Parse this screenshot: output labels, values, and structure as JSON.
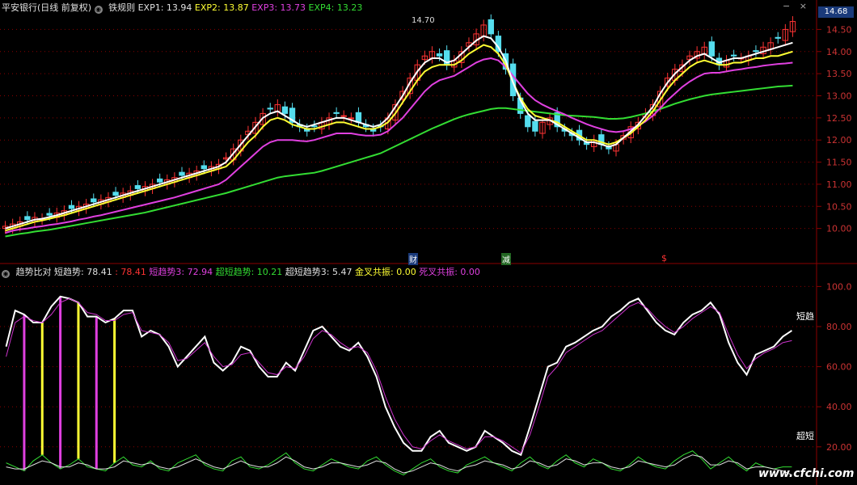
{
  "header_top": {
    "security": "平安银行(日线 前复权)",
    "indicator": "铁规则",
    "exp1": "EXP1: 13.94",
    "exp2": "EXP2: 13.87",
    "exp3": "EXP3: 13.73",
    "exp4": "EXP4: 13.23"
  },
  "header_bottom": {
    "indicator": "趋势比对",
    "short_trend": "短趋势: 78.41",
    "short_trend_val": ": 78.41",
    "short_trend3": "短趋势3: 72.94",
    "super_short": "超短趋势: 10.21",
    "super_short3": "超短趋势3: 5.47",
    "golden_cross": "金叉共振: 0.00",
    "death_cross": "死叉共振: 0.00"
  },
  "current_price": "14.68",
  "high_label": "14.70",
  "markers": {
    "cai": "财",
    "jian": "减",
    "dollar": "$"
  },
  "side_labels": {
    "short": "短趋",
    "super_short": "超短"
  },
  "watermark": "www.cfchi.com",
  "window_icons": {
    "minimize": "−",
    "close": "×"
  },
  "colors": {
    "up": "#ff3333",
    "down": "#55ddee",
    "exp1": "#ffffff",
    "exp2": "#ffff33",
    "exp3": "#e040e0",
    "exp4": "#33dd33",
    "grid": "#8b0000"
  },
  "chart_data": [
    {
      "type": "candlestick",
      "title": "铁规则",
      "ylim": [
        9.5,
        14.8
      ],
      "yticks": [
        "14.50",
        "14.00",
        "13.50",
        "13.00",
        "12.50",
        "12.00",
        "11.50",
        "11.00",
        "10.50",
        "10.00"
      ],
      "ytick_values": [
        14.5,
        14.0,
        13.5,
        13.0,
        12.5,
        12.0,
        11.5,
        11.0,
        10.5,
        10.0
      ],
      "close": [
        10.05,
        10.1,
        10.15,
        10.2,
        10.25,
        10.22,
        10.3,
        10.35,
        10.4,
        10.45,
        10.5,
        10.55,
        10.6,
        10.65,
        10.7,
        10.75,
        10.8,
        10.85,
        10.9,
        10.95,
        11.0,
        11.05,
        11.1,
        11.15,
        11.2,
        11.25,
        11.3,
        11.35,
        11.4,
        11.45,
        11.6,
        11.8,
        12.0,
        12.2,
        12.4,
        12.6,
        12.7,
        12.8,
        12.6,
        12.4,
        12.3,
        12.2,
        12.3,
        12.4,
        12.5,
        12.6,
        12.55,
        12.5,
        12.4,
        12.3,
        12.2,
        12.3,
        12.5,
        12.8,
        13.1,
        13.4,
        13.7,
        13.9,
        14.0,
        13.9,
        13.7,
        13.8,
        14.0,
        14.2,
        14.4,
        14.6,
        14.4,
        14.0,
        13.6,
        13.0,
        12.6,
        12.3,
        12.2,
        12.4,
        12.5,
        12.3,
        12.2,
        12.1,
        12.0,
        11.9,
        12.0,
        11.9,
        11.8,
        11.9,
        12.1,
        12.3,
        12.4,
        12.6,
        12.8,
        13.1,
        13.4,
        13.6,
        13.7,
        13.9,
        14.0,
        14.1,
        13.9,
        13.7,
        13.8,
        13.9,
        13.85,
        13.9,
        14.0,
        14.1,
        14.2,
        14.3,
        14.5,
        14.68
      ],
      "exp1": [
        10.0,
        10.05,
        10.1,
        10.15,
        10.2,
        10.22,
        10.26,
        10.3,
        10.35,
        10.4,
        10.45,
        10.5,
        10.55,
        10.6,
        10.65,
        10.7,
        10.75,
        10.8,
        10.85,
        10.9,
        10.95,
        11.0,
        11.05,
        11.1,
        11.15,
        11.2,
        11.25,
        11.3,
        11.35,
        11.4,
        11.5,
        11.7,
        11.9,
        12.1,
        12.3,
        12.5,
        12.6,
        12.65,
        12.55,
        12.45,
        12.35,
        12.3,
        12.35,
        12.4,
        12.45,
        12.5,
        12.5,
        12.45,
        12.4,
        12.35,
        12.3,
        12.35,
        12.5,
        12.75,
        13.0,
        13.3,
        13.55,
        13.75,
        13.85,
        13.85,
        13.75,
        13.8,
        13.95,
        14.1,
        14.25,
        14.35,
        14.3,
        14.1,
        13.8,
        13.3,
        12.9,
        12.6,
        12.45,
        12.45,
        12.45,
        12.35,
        12.25,
        12.15,
        12.05,
        11.95,
        11.95,
        11.9,
        11.85,
        11.9,
        12.05,
        12.2,
        12.35,
        12.55,
        12.75,
        13.05,
        13.3,
        13.5,
        13.65,
        13.8,
        13.9,
        13.95,
        13.85,
        13.75,
        13.8,
        13.85,
        13.85,
        13.9,
        13.95,
        14.0,
        14.05,
        14.1,
        14.15,
        14.2
      ],
      "exp2": [
        9.95,
        10.0,
        10.05,
        10.1,
        10.15,
        10.18,
        10.22,
        10.26,
        10.3,
        10.35,
        10.4,
        10.45,
        10.5,
        10.55,
        10.6,
        10.65,
        10.7,
        10.75,
        10.8,
        10.85,
        10.9,
        10.95,
        11.0,
        11.05,
        11.1,
        11.15,
        11.2,
        11.25,
        11.3,
        11.35,
        11.4,
        11.55,
        11.75,
        11.95,
        12.1,
        12.3,
        12.45,
        12.5,
        12.45,
        12.35,
        12.3,
        12.25,
        12.25,
        12.3,
        12.35,
        12.4,
        12.4,
        12.35,
        12.3,
        12.25,
        12.25,
        12.3,
        12.4,
        12.6,
        12.85,
        13.1,
        13.35,
        13.55,
        13.65,
        13.7,
        13.7,
        13.7,
        13.8,
        13.95,
        14.05,
        14.15,
        14.1,
        13.95,
        13.7,
        13.3,
        12.95,
        12.7,
        12.55,
        12.5,
        12.45,
        12.4,
        12.3,
        12.2,
        12.1,
        12.0,
        12.0,
        11.95,
        11.9,
        11.95,
        12.05,
        12.15,
        12.3,
        12.45,
        12.65,
        12.9,
        13.15,
        13.35,
        13.5,
        13.65,
        13.75,
        13.8,
        13.75,
        13.7,
        13.7,
        13.75,
        13.75,
        13.8,
        13.85,
        13.85,
        13.9,
        13.9,
        13.95,
        14.0
      ],
      "exp3": [
        9.9,
        9.95,
        9.98,
        10.0,
        10.03,
        10.05,
        10.08,
        10.1,
        10.13,
        10.16,
        10.2,
        10.23,
        10.27,
        10.3,
        10.34,
        10.38,
        10.42,
        10.46,
        10.5,
        10.54,
        10.58,
        10.62,
        10.66,
        10.7,
        10.75,
        10.8,
        10.85,
        10.9,
        10.95,
        11.0,
        11.1,
        11.25,
        11.4,
        11.55,
        11.7,
        11.85,
        11.95,
        12.0,
        12.0,
        12.0,
        11.98,
        11.97,
        12.0,
        12.05,
        12.1,
        12.15,
        12.15,
        12.15,
        12.12,
        12.1,
        12.1,
        12.12,
        12.2,
        12.35,
        12.5,
        12.7,
        12.9,
        13.1,
        13.25,
        13.35,
        13.4,
        13.45,
        13.55,
        13.65,
        13.75,
        13.82,
        13.85,
        13.8,
        13.65,
        13.45,
        13.25,
        13.05,
        12.9,
        12.8,
        12.72,
        12.65,
        12.58,
        12.5,
        12.43,
        12.36,
        12.3,
        12.25,
        12.2,
        12.18,
        12.2,
        12.25,
        12.32,
        12.42,
        12.55,
        12.72,
        12.9,
        13.05,
        13.2,
        13.32,
        13.42,
        13.5,
        13.52,
        13.52,
        13.55,
        13.58,
        13.6,
        13.63,
        13.65,
        13.68,
        13.7,
        13.72,
        13.73,
        13.75
      ],
      "exp4": [
        9.82,
        9.85,
        9.88,
        9.9,
        9.93,
        9.95,
        9.97,
        10.0,
        10.03,
        10.06,
        10.09,
        10.12,
        10.15,
        10.18,
        10.21,
        10.24,
        10.27,
        10.3,
        10.33,
        10.36,
        10.4,
        10.44,
        10.48,
        10.52,
        10.56,
        10.6,
        10.64,
        10.68,
        10.72,
        10.76,
        10.8,
        10.85,
        10.9,
        10.95,
        11.0,
        11.05,
        11.1,
        11.15,
        11.18,
        11.2,
        11.22,
        11.24,
        11.26,
        11.3,
        11.35,
        11.4,
        11.45,
        11.5,
        11.55,
        11.6,
        11.65,
        11.7,
        11.78,
        11.86,
        11.94,
        12.02,
        12.1,
        12.18,
        12.26,
        12.33,
        12.4,
        12.47,
        12.53,
        12.58,
        12.62,
        12.66,
        12.7,
        12.72,
        12.72,
        12.7,
        12.68,
        12.66,
        12.64,
        12.62,
        12.6,
        12.58,
        12.56,
        12.55,
        12.54,
        12.53,
        12.52,
        12.5,
        12.48,
        12.48,
        12.49,
        12.52,
        12.56,
        12.6,
        12.65,
        12.7,
        12.76,
        12.82,
        12.87,
        12.92,
        12.96,
        13.0,
        13.03,
        13.05,
        13.07,
        13.09,
        13.11,
        13.13,
        13.15,
        13.17,
        13.19,
        13.21,
        13.22,
        13.23
      ]
    },
    {
      "type": "line",
      "title": "趋势比对",
      "ylim": [
        5,
        105
      ],
      "yticks": [
        "100.0",
        "80.00",
        "60.00",
        "40.00",
        "20.00"
      ],
      "ytick_values": [
        100,
        80,
        60,
        40,
        20
      ],
      "series": [
        {
          "name": "短趋势",
          "values": [
            70,
            88,
            86,
            82,
            82,
            90,
            95,
            94,
            92,
            85,
            85,
            82,
            84,
            88,
            88,
            75,
            78,
            76,
            70,
            60,
            65,
            70,
            75,
            62,
            58,
            62,
            70,
            68,
            60,
            55,
            55,
            62,
            58,
            68,
            78,
            80,
            75,
            70,
            68,
            72,
            65,
            55,
            40,
            30,
            22,
            18,
            18,
            25,
            28,
            22,
            20,
            18,
            20,
            28,
            25,
            22,
            18,
            16,
            30,
            45,
            60,
            62,
            70,
            72,
            75,
            78,
            80,
            85,
            88,
            92,
            94,
            88,
            82,
            78,
            76,
            82,
            86,
            88,
            92,
            86,
            72,
            62,
            56,
            66,
            68,
            70,
            75,
            78
          ]
        },
        {
          "name": "短趋势3",
          "values": [
            65,
            82,
            85,
            83,
            82,
            86,
            92,
            94,
            92,
            87,
            86,
            83,
            83,
            86,
            87,
            78,
            77,
            76,
            72,
            63,
            64,
            68,
            72,
            65,
            60,
            61,
            66,
            67,
            62,
            57,
            56,
            60,
            59,
            65,
            74,
            78,
            76,
            72,
            69,
            70,
            67,
            58,
            45,
            34,
            26,
            20,
            19,
            23,
            26,
            23,
            21,
            19,
            20,
            25,
            25,
            23,
            20,
            17,
            26,
            40,
            55,
            60,
            67,
            70,
            73,
            76,
            78,
            82,
            86,
            90,
            92,
            89,
            84,
            80,
            77,
            80,
            84,
            87,
            90,
            87,
            76,
            66,
            59,
            64,
            67,
            69,
            72,
            73
          ]
        },
        {
          "name": "超短趋势",
          "values": [
            12,
            10,
            8,
            13,
            16,
            12,
            9,
            11,
            14,
            10,
            9,
            8,
            12,
            15,
            11,
            10,
            13,
            9,
            8,
            12,
            14,
            16,
            11,
            9,
            8,
            13,
            15,
            10,
            9,
            11,
            14,
            17,
            12,
            9,
            8,
            11,
            14,
            12,
            10,
            9,
            13,
            15,
            11,
            8,
            6,
            9,
            12,
            14,
            10,
            8,
            7,
            11,
            13,
            15,
            12,
            10,
            8,
            12,
            15,
            11,
            9,
            13,
            16,
            12,
            10,
            14,
            12,
            9,
            8,
            11,
            15,
            12,
            10,
            9,
            13,
            16,
            18,
            14,
            9,
            12,
            15,
            11,
            8,
            12,
            10,
            9,
            10,
            10
          ]
        },
        {
          "name": "超短趋势3",
          "values": [
            10,
            9,
            9,
            11,
            13,
            12,
            10,
            10,
            12,
            11,
            9,
            9,
            10,
            13,
            12,
            11,
            12,
            10,
            9,
            10,
            12,
            14,
            12,
            10,
            9,
            11,
            13,
            11,
            10,
            10,
            12,
            15,
            13,
            10,
            9,
            10,
            12,
            12,
            11,
            10,
            11,
            13,
            12,
            9,
            7,
            8,
            10,
            12,
            11,
            9,
            8,
            10,
            11,
            13,
            12,
            11,
            9,
            10,
            13,
            12,
            10,
            11,
            14,
            13,
            11,
            12,
            12,
            10,
            9,
            10,
            13,
            12,
            11,
            10,
            11,
            14,
            16,
            15,
            11,
            11,
            13,
            12,
            9,
            10,
            10,
            9,
            8,
            6
          ]
        }
      ]
    }
  ]
}
